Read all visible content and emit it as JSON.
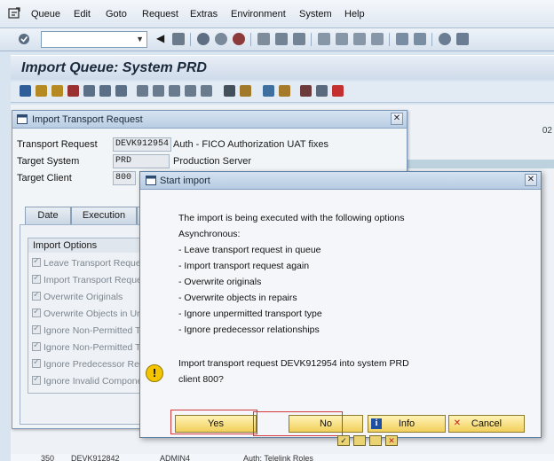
{
  "menu": {
    "items": [
      "Queue",
      "Edit",
      "Goto",
      "Request",
      "Extras",
      "Environment",
      "System",
      "Help"
    ]
  },
  "command_field": {
    "value": ""
  },
  "page_title": "Import Queue: System PRD",
  "background": {
    "right_label": "02",
    "bottom_row": [
      "350",
      "DEVK912842",
      "ADMIN4",
      "Auth: Telelink Roles"
    ]
  },
  "import_dialog": {
    "title": "Import Transport Request",
    "fields": [
      {
        "label": "Transport Request",
        "value": "DEVK912954",
        "description": "Auth - FICO Authorization UAT fixes"
      },
      {
        "label": "Target System",
        "value": "PRD",
        "description": "Production Server"
      },
      {
        "label": "Target Client",
        "value": "800",
        "description": ""
      }
    ],
    "tabs": [
      "Date",
      "Execution"
    ],
    "options_header": "Import Options",
    "options": [
      "Leave Transport Request",
      "Import Transport Reques",
      "Overwrite Originals",
      "Overwrite Objects in Unc",
      "Ignore Non-Permitted Tra",
      "Ignore Non-Permitted Ta",
      "Ignore Predecessor Relati",
      "Ignore Invalid Compone"
    ]
  },
  "start_dialog": {
    "title": "Start import",
    "lines": [
      "The import is being executed with the following options",
      "Asynchronous:",
      "- Leave transport request in queue",
      "- Import transport request again",
      "- Overwrite originals",
      "- Overwrite objects in repairs",
      "- Ignore unpermitted transport type",
      "- Ignore predecessor relationships"
    ],
    "question_line1": "Import transport request DEVK912954 into system PRD",
    "question_line2": "client 800?",
    "buttons": {
      "yes": "Yes",
      "no": "No",
      "info": "Info",
      "cancel": "Cancel"
    }
  },
  "icons": {
    "app": "sap-menu-icon",
    "warning": "exclamation-icon",
    "info": "info-icon",
    "cancel": "cancel-x-icon"
  },
  "colors": {
    "accent": "#d23a3a",
    "button": "#f1cf5a",
    "warning": "#f3c400"
  }
}
